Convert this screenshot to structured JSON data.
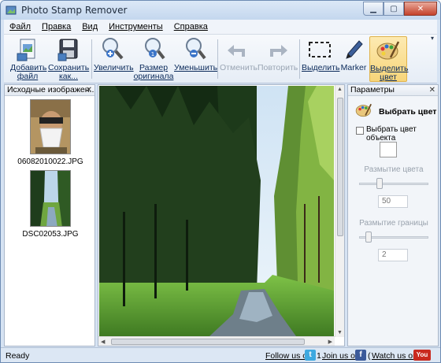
{
  "window": {
    "title": "Photo Stamp Remover"
  },
  "menu": [
    {
      "label": "Файл",
      "hotkey_index": 0
    },
    {
      "label": "Правка",
      "hotkey_index": 0
    },
    {
      "label": "Вид",
      "hotkey_index": 0
    },
    {
      "label": "Инструменты",
      "hotkey_index": 0
    },
    {
      "label": "Справка",
      "hotkey_index": 0
    }
  ],
  "toolbar": {
    "add_file": "Добавить файл",
    "save_as": "Сохранить как...",
    "zoom_in": "Увеличить",
    "original_size": "Размер оригинала",
    "zoom_out": "Уменьшить",
    "undo": "Отменить",
    "redo": "Повторить",
    "select": "Выделить",
    "marker": "Marker",
    "select_color": "Выделить цвет",
    "more": "▾"
  },
  "left_panel": {
    "title": "Исходные изображен...",
    "files": [
      {
        "name": "06082010022.JPG"
      },
      {
        "name": "DSC02053.JPG"
      }
    ]
  },
  "right_panel": {
    "title": "Параметры",
    "tool_title": "Выбрать цвет",
    "checkbox_label": "Выбрать цвет объекта",
    "checkbox_checked": false,
    "color_blur_label": "Размытие цвета",
    "color_blur_value": "50",
    "border_blur_label": "Размытие границы",
    "border_blur_value": "2"
  },
  "status": {
    "text": "Ready",
    "follow": "Follow us on",
    "join": "Join us on",
    "watch": "Watch us on",
    "prefix_1": "1",
    "prefix_2": "("
  },
  "colors": {
    "accent": "#fbe29a",
    "titlebar": "#c4d7ee",
    "panel_bg": "#f2f5f9"
  }
}
